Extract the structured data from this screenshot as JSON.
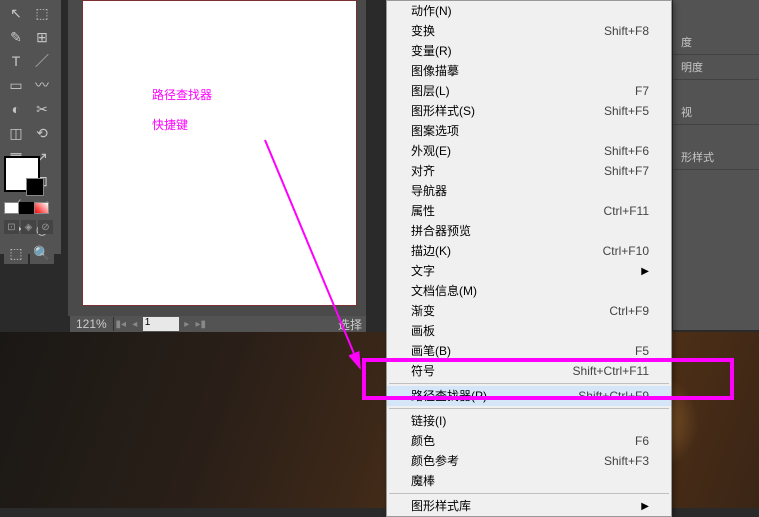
{
  "annotation": {
    "line1": "路径查找器",
    "line2": "快捷键"
  },
  "toolbar": {
    "tools": [
      "↖",
      "⬚",
      "✎",
      "⊞",
      "T",
      "／",
      "▭",
      "〰",
      "◐",
      "✂",
      "◫",
      "⟲",
      "▦",
      "↗",
      "✥",
      "⊡",
      "⟋",
      "◢",
      "✥",
      "◉",
      "⬚",
      "🔍"
    ]
  },
  "color": {
    "miniIcons": [
      "⊡",
      "◈",
      "⊘"
    ]
  },
  "status": {
    "zoom": "121%",
    "page": "1",
    "selectText": "选择"
  },
  "rightPanel": {
    "items": [
      "度",
      "明度",
      "视",
      "形样式"
    ]
  },
  "menu": {
    "groups": [
      [
        {
          "label": "动作(N)",
          "shortcut": ""
        },
        {
          "label": "变换",
          "shortcut": "Shift+F8"
        },
        {
          "label": "变量(R)",
          "shortcut": ""
        },
        {
          "label": "图像描摹",
          "shortcut": ""
        },
        {
          "label": "图层(L)",
          "shortcut": "F7"
        },
        {
          "label": "图形样式(S)",
          "shortcut": "Shift+F5"
        },
        {
          "label": "图案选项",
          "shortcut": ""
        },
        {
          "label": "外观(E)",
          "shortcut": "Shift+F6"
        },
        {
          "label": "对齐",
          "shortcut": "Shift+F7"
        },
        {
          "label": "导航器",
          "shortcut": ""
        },
        {
          "label": "属性",
          "shortcut": "Ctrl+F11"
        },
        {
          "label": "拼合器预览",
          "shortcut": ""
        },
        {
          "label": "描边(K)",
          "shortcut": "Ctrl+F10"
        },
        {
          "label": "文字",
          "shortcut": "",
          "submenu": true
        },
        {
          "label": "文档信息(M)",
          "shortcut": ""
        },
        {
          "label": "渐变",
          "shortcut": "Ctrl+F9"
        },
        {
          "label": "画板",
          "shortcut": ""
        },
        {
          "label": "画笔(B)",
          "shortcut": "F5"
        },
        {
          "label": "符号",
          "shortcut": "Shift+Ctrl+F11"
        }
      ],
      [
        {
          "label": "路径查找器(P)",
          "shortcut": "Shift+Ctrl+F9",
          "highlight": true
        }
      ],
      [
        {
          "label": "链接(I)",
          "shortcut": ""
        },
        {
          "label": "颜色",
          "shortcut": "F6"
        },
        {
          "label": "颜色参考",
          "shortcut": "Shift+F3"
        },
        {
          "label": "魔棒",
          "shortcut": ""
        }
      ],
      [
        {
          "label": "图形样式库",
          "shortcut": "",
          "submenu": true
        }
      ]
    ]
  },
  "chart_data": null
}
